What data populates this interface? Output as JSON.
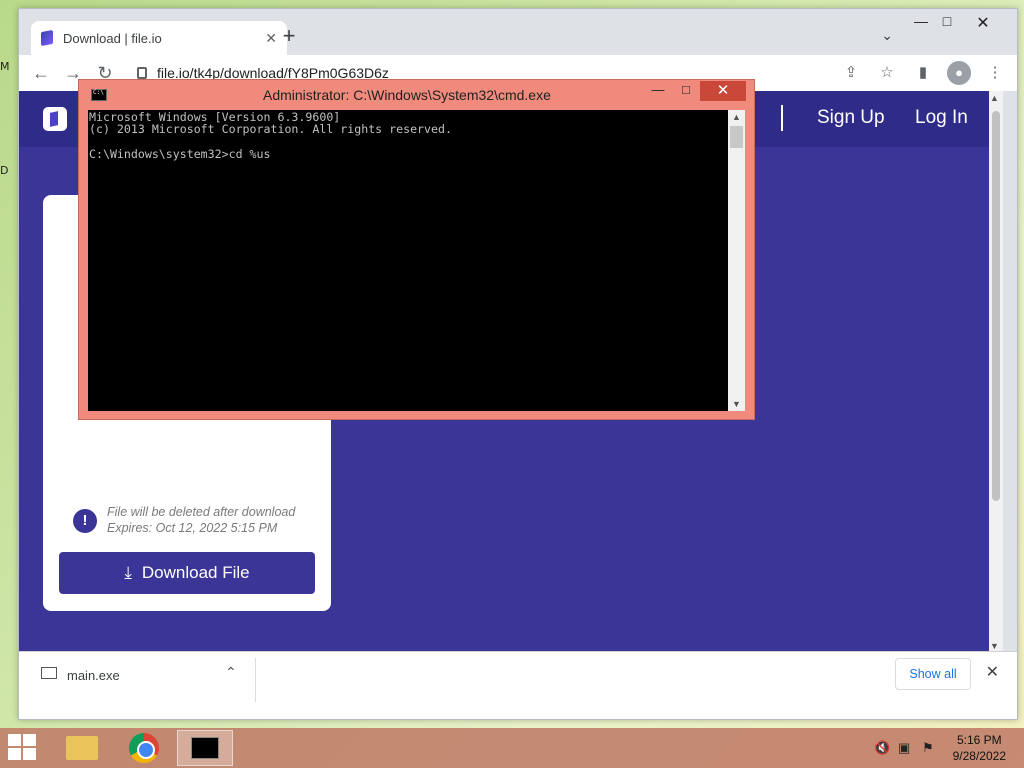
{
  "browser": {
    "tab_title": "Download | file.io",
    "tab_close": "✕",
    "new_tab": "+",
    "url": "file.io/tk4p/download/fY8Pm0G63D6z",
    "nav": {
      "back": "←",
      "forward": "→",
      "reload": "↻"
    }
  },
  "site": {
    "header_links": [
      "Sign Up",
      "Log In"
    ],
    "info_line1": "File will be deleted after download",
    "info_line2": "Expires: Oct 12, 2022 5:15 PM",
    "info_icon": "!",
    "download_button": "Download File"
  },
  "download_bar": {
    "file_name": "main.exe",
    "show_all": "Show all",
    "close": "✕"
  },
  "cmd": {
    "title": "Administrator: C:\\Windows\\System32\\cmd.exe",
    "lines": [
      "Microsoft Windows [Version 6.3.9600]",
      "(c) 2013 Microsoft Corporation. All rights reserved.",
      "",
      "C:\\Windows\\system32>cd %us"
    ]
  },
  "taskbar": {
    "time": "5:16 PM",
    "date": "9/28/2022"
  },
  "desktop": {
    "peek1": "M",
    "peek2": "D"
  },
  "colors": {
    "site_bg": "#3b3597",
    "header_bg": "#2f2b88",
    "cmd_frame": "#f08a7c"
  }
}
